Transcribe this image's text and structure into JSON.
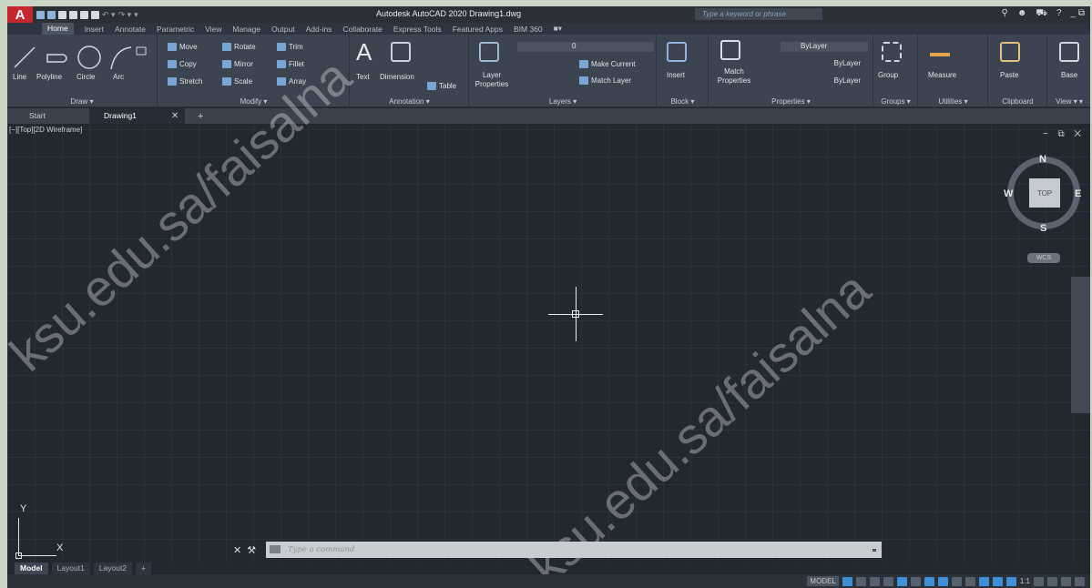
{
  "titlebar": {
    "logo": "A",
    "title": "Autodesk AutoCAD 2020   Drawing1.dwg",
    "search_placeholder": "Type a keyword or phrase",
    "controls": "_  ⧉"
  },
  "tabs": [
    "Home",
    "Insert",
    "Annotate",
    "Parametric",
    "View",
    "Manage",
    "Output",
    "Add-ins",
    "Collaborate",
    "Express Tools",
    "Featured Apps",
    "BIM 360"
  ],
  "ribbon": {
    "draw": {
      "title": "Draw ▾",
      "line": "Line",
      "polyline": "Polyline",
      "circle": "Circle",
      "arc": "Arc"
    },
    "modify": {
      "title": "Modify ▾",
      "move": "Move",
      "rotate": "Rotate",
      "trim": "Trim",
      "copy": "Copy",
      "mirror": "Mirror",
      "fillet": "Fillet",
      "stretch": "Stretch",
      "scale": "Scale",
      "array": "Array"
    },
    "annotation": {
      "title": "Annotation ▾",
      "text": "Text",
      "dimension": "Dimension",
      "table": "Table"
    },
    "layers": {
      "title": "Layers ▾",
      "layer_properties": "Layer Properties",
      "layer_value": "0",
      "make_current": "Make Current",
      "match_layer": "Match Layer"
    },
    "block": {
      "title": "Block ▾",
      "insert": "Insert"
    },
    "properties": {
      "title": "Properties ▾",
      "match_properties": "Match Properties",
      "bylayer1": "ByLayer",
      "bylayer2": "ByLayer",
      "bylayer3": "ByLayer"
    },
    "groups": {
      "title": "Groups ▾",
      "group": "Group"
    },
    "utilities": {
      "title": "Utilities ▾",
      "measure": "Measure"
    },
    "clipboard": {
      "title": "Clipboard",
      "paste": "Paste"
    },
    "view": {
      "title": "View ▾ ▾",
      "base": "Base"
    }
  },
  "doc_tabs": {
    "start": "Start",
    "drawing": "Drawing1",
    "close": "✕",
    "plus": "+"
  },
  "viewport": {
    "label": "[−][Top][2D Wireframe]",
    "controls": "− ⧉ ✕"
  },
  "viewcube": {
    "n": "N",
    "s": "S",
    "e": "E",
    "w": "W",
    "top": "TOP",
    "wcs": "WCS"
  },
  "ucs": {
    "x": "X",
    "y": "Y"
  },
  "command": {
    "placeholder": "Type a command",
    "close": "✕",
    "wrench": "🔧"
  },
  "layout_tabs": [
    "Model",
    "Layout1",
    "Layout2",
    "+"
  ],
  "status": {
    "model": "MODEL",
    "scale": "1:1"
  },
  "watermark": [
    "ksu.edu.sa/faisalna",
    "ksu.edu.sa/faisalna",
    "ksu.edu.sa/faisalna"
  ],
  "colors": {
    "accent": "#c6262e",
    "canvas": "#212830",
    "ribbon": "#3b4450",
    "active_button": "#3f8fd6"
  }
}
